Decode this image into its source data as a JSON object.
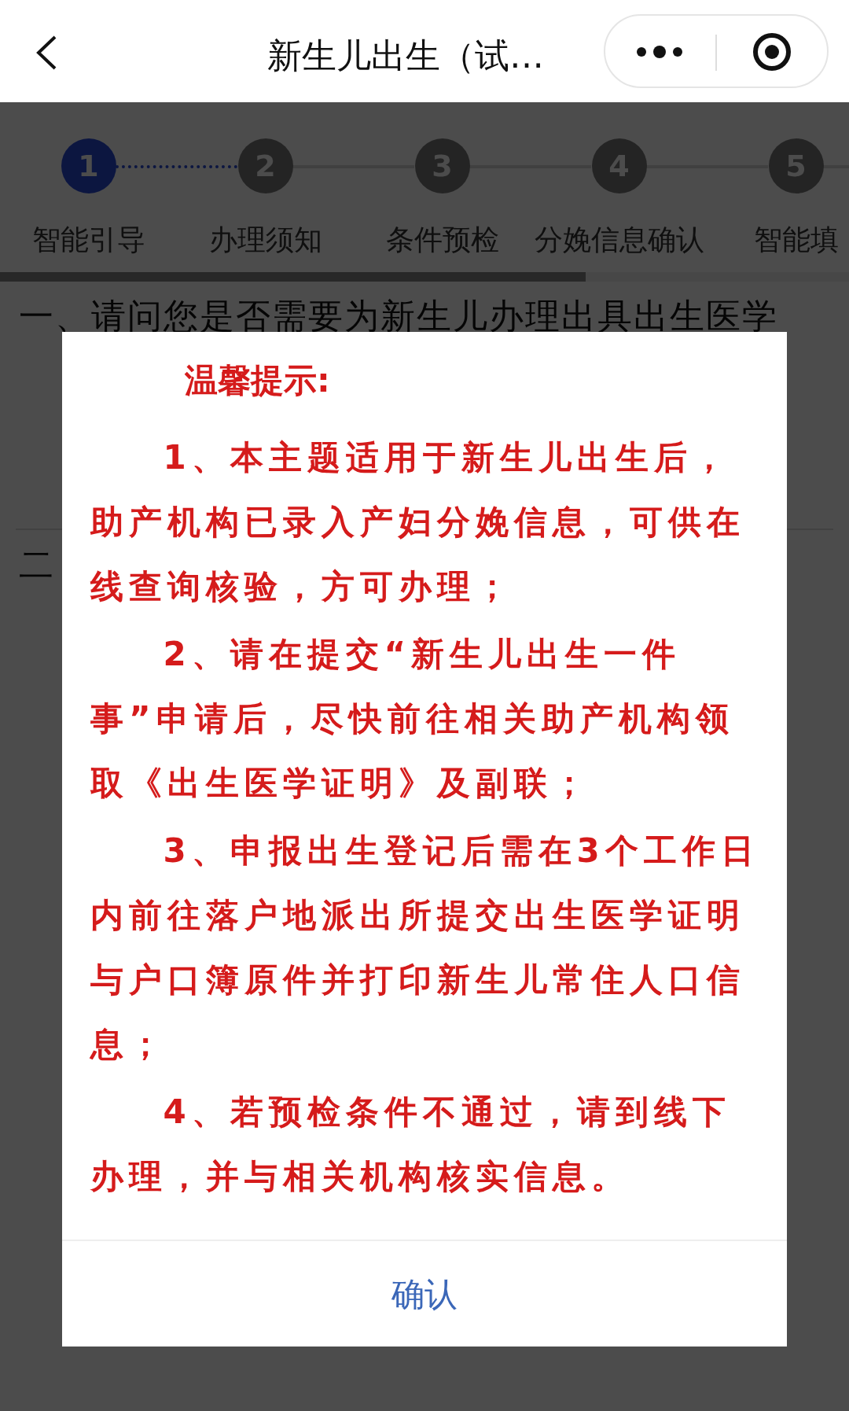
{
  "header": {
    "title": "新生儿出生（试…"
  },
  "steps": [
    {
      "number": "1",
      "label": "智能引导",
      "selected": true
    },
    {
      "number": "2",
      "label": "办理须知",
      "selected": false
    },
    {
      "number": "3",
      "label": "条件预检",
      "selected": false
    },
    {
      "number": "4",
      "label": "分娩信息确认",
      "selected": false
    },
    {
      "number": "5",
      "label": "智能填",
      "selected": false
    }
  ],
  "progress": {
    "level": 0.69
  },
  "questions": [
    "一、请问您是否需要为新生儿办理出具出生医学",
    "二"
  ],
  "dialog": {
    "title": "温馨提示:",
    "paragraphs": [
      "1、本主题适用于新生儿出生后，助产机构已录入产妇分娩信息，可供在线查询核验，方可办理；",
      "2、请在提交“新生儿出生一件事”申请后，尽快前往相关助产机构领取《出生医学证明》及副联；",
      "3、申报出生登记后需在3个工作日内前往落户地派出所提交出生医学证明与户口簿原件并打印新生儿常住人口信息；",
      "4、若预检条件不通过，请到线下办理，并与相关机构核实信息。"
    ],
    "button": "确认"
  }
}
